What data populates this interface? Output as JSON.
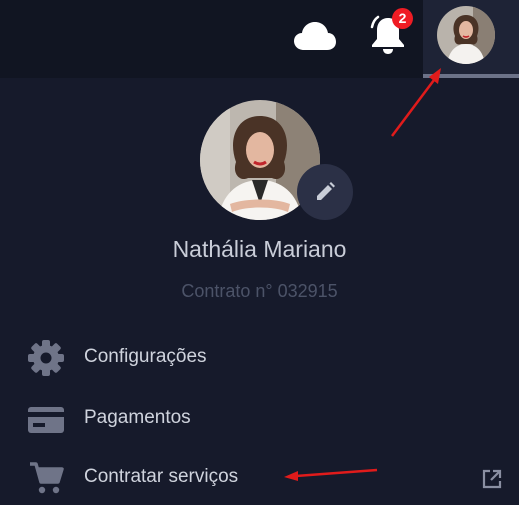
{
  "header": {
    "notification_count": "2",
    "icons": [
      "cloud-icon",
      "bell-icon"
    ]
  },
  "profile": {
    "name": "Nathália Mariano",
    "contract": "Contrato n° 032915"
  },
  "menu": {
    "items": [
      {
        "label": "Configurações",
        "icon": "gear-icon"
      },
      {
        "label": "Pagamentos",
        "icon": "credit-card-icon"
      },
      {
        "label": "Contratar serviços",
        "icon": "cart-icon"
      }
    ]
  },
  "colors": {
    "background": "#161a2b",
    "topbar": "#111522",
    "badge": "#ef1c24",
    "annotation_arrow": "#e01b1b"
  }
}
